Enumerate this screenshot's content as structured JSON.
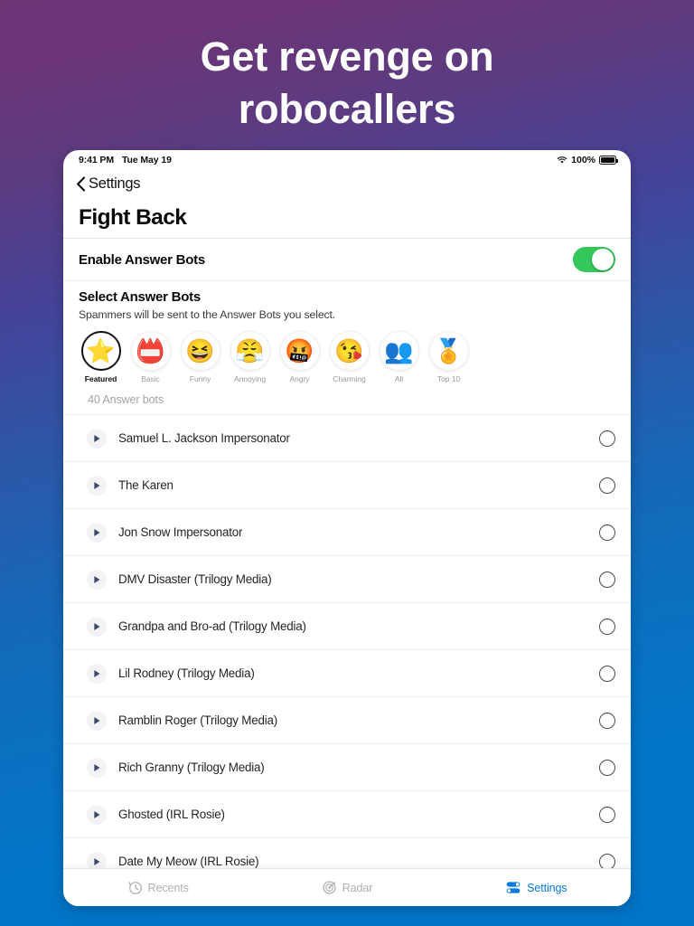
{
  "marketing": {
    "headline_line1": "Get revenge on",
    "headline_line2": "robocallers"
  },
  "statusbar": {
    "time": "9:41 PM",
    "date": "Tue May 19",
    "wifi_icon": "wifi-icon",
    "battery_percent": "100%",
    "battery_icon": "battery-full-icon"
  },
  "nav": {
    "back_icon": "chevron-left-icon",
    "back_label": "Settings",
    "page_title": "Fight Back"
  },
  "enable": {
    "label": "Enable Answer Bots",
    "toggle_state": "on",
    "toggle_color": "#34c759"
  },
  "select_section": {
    "title": "Select Answer Bots",
    "subtitle": "Spammers will be sent to the Answer Bots you select."
  },
  "categories": [
    {
      "label": "Featured",
      "icon": "star-icon",
      "glyph": "⭐",
      "selected": true
    },
    {
      "label": "Basic",
      "icon": "name-badge-icon",
      "glyph": "📛",
      "selected": false
    },
    {
      "label": "Funny",
      "icon": "laughing-face-icon",
      "glyph": "😆",
      "selected": false
    },
    {
      "label": "Annoying",
      "icon": "annoyed-face-icon",
      "glyph": "😤",
      "selected": false
    },
    {
      "label": "Angry",
      "icon": "cursing-face-icon",
      "glyph": "🤬",
      "selected": false
    },
    {
      "label": "Charming",
      "icon": "winking-kiss-icon",
      "glyph": "😘",
      "selected": false
    },
    {
      "label": "All",
      "icon": "group-faces-icon",
      "glyph": "👥",
      "selected": false
    },
    {
      "label": "Top 10",
      "icon": "medal-icon",
      "glyph": "🏅",
      "selected": false
    }
  ],
  "list": {
    "count_label": "40 Answer bots",
    "play_icon": "play-icon",
    "radio_icon": "radio-unselected-icon",
    "rows": [
      {
        "name": "Samuel L. Jackson Impersonator",
        "selected": false
      },
      {
        "name": "The Karen",
        "selected": false
      },
      {
        "name": "Jon Snow Impersonator",
        "selected": false
      },
      {
        "name": "DMV Disaster (Trilogy Media)",
        "selected": false
      },
      {
        "name": "Grandpa and Bro-ad (Trilogy Media)",
        "selected": false
      },
      {
        "name": "Lil Rodney (Trilogy Media)",
        "selected": false
      },
      {
        "name": "Ramblin Roger (Trilogy Media)",
        "selected": false
      },
      {
        "name": "Rich Granny (Trilogy Media)",
        "selected": false
      },
      {
        "name": "Ghosted (IRL Rosie)",
        "selected": false
      },
      {
        "name": "Date My Meow (IRL Rosie)",
        "selected": false
      }
    ]
  },
  "tabbar": {
    "active_color": "#0a7ae0",
    "inactive_color": "#b0b0b0",
    "tabs": [
      {
        "label": "Recents",
        "icon": "clock-history-icon",
        "active": false
      },
      {
        "label": "Radar",
        "icon": "radar-icon",
        "active": false
      },
      {
        "label": "Settings",
        "icon": "sliders-icon",
        "active": true
      }
    ]
  }
}
